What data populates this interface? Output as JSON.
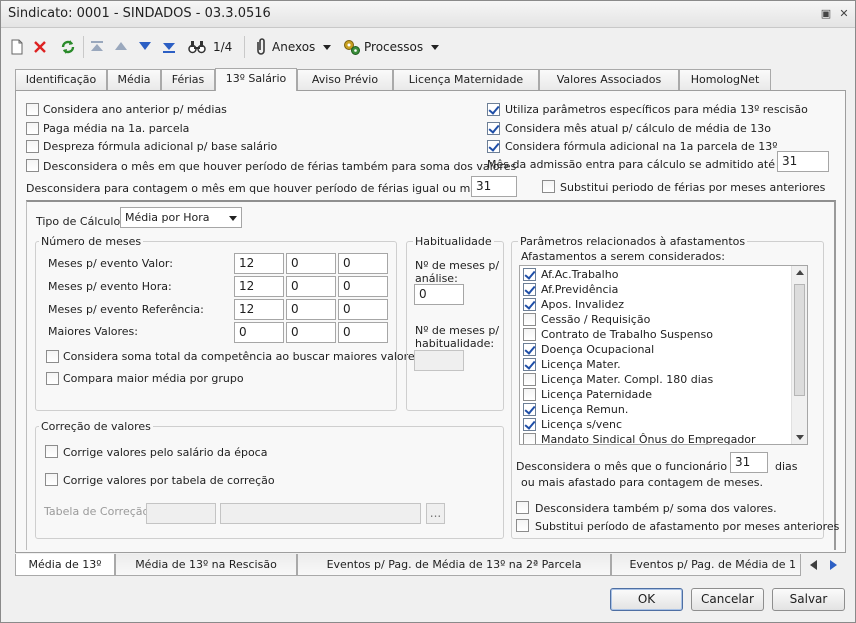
{
  "window": {
    "title": "Sindicato: 0001 - SINDADOS - 03.3.0516",
    "title_buttons": [
      "▣",
      "✕"
    ]
  },
  "toolbar": {
    "record_count": "1/4",
    "annexes_label": "Anexos",
    "processes_label": "Processos"
  },
  "tabs": [
    "Identificação",
    "Média",
    "Férias",
    "13º Salário",
    "Aviso Prévio",
    "Licença Maternidade",
    "Valores Associados",
    "HomologNet"
  ],
  "options": {
    "left": [
      {
        "label": "Considera ano anterior p/ médias",
        "checked": false
      },
      {
        "label": "Paga média na 1a. parcela",
        "checked": false
      },
      {
        "label": "Despreza fórmula adicional p/ base salário",
        "checked": false
      },
      {
        "label": "Desconsidera o mês em que houver período de férias também para soma dos valores",
        "checked": false
      }
    ],
    "right": [
      {
        "label": "Utiliza parâmetros específicos para média 13º rescisão",
        "checked": true
      },
      {
        "label": "Considera mês atual  p/ cálculo de média de 13o",
        "checked": true
      },
      {
        "label": "Considera fórmula adicional na  1a parcela de 13º",
        "checked": true
      }
    ],
    "admission_label": "Mês da admissão entra para cálculo se admitido até dia",
    "admission_value": "31",
    "vacation_count_label": "Desconsidera para contagem o mês em que houver período de férias igual ou maior a",
    "vacation_count_value": "31",
    "replace_vacation_label": "Substitui periodo de  férias por meses anteriores",
    "replace_vacation_checked": false
  },
  "calc": {
    "type_label": "Tipo de Cálculo",
    "type_value": "Média por Hora"
  },
  "months_group": {
    "title": "Número de meses",
    "rows": [
      {
        "label": "Meses p/ evento Valor:",
        "values": [
          "12",
          "0",
          "0"
        ]
      },
      {
        "label": "Meses p/ evento Hora:",
        "values": [
          "12",
          "0",
          "0"
        ]
      },
      {
        "label": "Meses p/ evento Referência:",
        "values": [
          "12",
          "0",
          "0"
        ]
      },
      {
        "label": "Maiores Valores:",
        "values": [
          "0",
          "0",
          "0"
        ]
      }
    ],
    "sum_total_label": "Considera soma total da competência ao buscar maiores valores",
    "compare_group_label": "Compara maior média por grupo"
  },
  "habituality": {
    "title": "Habitualidade",
    "analysis_label_1": "Nº de meses p/",
    "analysis_label_2": "análise:",
    "analysis_value": "0",
    "habit_label_1": "Nº de meses p/",
    "habit_label_2": "habitualidade:",
    "habit_value": ""
  },
  "absence": {
    "title": "Parâmetros relacionados à afastamentos",
    "list_label": "Afastamentos a serem considerados:",
    "items": [
      {
        "label": "Af.Ac.Trabalho",
        "checked": true
      },
      {
        "label": "Af.Previdência",
        "checked": true
      },
      {
        "label": "Apos. Invalidez",
        "checked": true
      },
      {
        "label": "Cessão / Requisição",
        "checked": false
      },
      {
        "label": "Contrato de Trabalho Suspenso",
        "checked": false
      },
      {
        "label": "Doença Ocupacional",
        "checked": true
      },
      {
        "label": "Licença Mater.",
        "checked": true
      },
      {
        "label": "Licença Mater. Compl. 180 dias",
        "checked": false
      },
      {
        "label": "Licença Paternidade",
        "checked": false
      },
      {
        "label": "Licença Remun.",
        "checked": true
      },
      {
        "label": "Licença s/venc",
        "checked": true
      },
      {
        "label": "Mandato Sindical Ônus do Empregador",
        "checked": false
      }
    ],
    "disregard_label_1": "Desconsidera o mês que o funcionário ficar",
    "disregard_value": "31",
    "disregard_days": "dias",
    "disregard_label_2": "ou mais afastado para contagem de meses.",
    "also_sum_label": "Desconsidera também p/ soma dos valores.",
    "replace_label": "Substitui período de afastamento por meses anteriores"
  },
  "correction": {
    "title": "Correção de valores",
    "by_salary_label": "Corrige valores pelo salário da época",
    "by_table_label": "Corrige valores por tabela de correção",
    "table_label": "Tabela de Correção:",
    "browse_label": "..."
  },
  "bottom_tabs": [
    "Média de 13º",
    "Média de 13º na Rescisão",
    "Eventos p/ Pag. de Média de 13º na 2ª Parcela",
    "Eventos p/ Pag. de Média de 1"
  ],
  "buttons": {
    "ok": "OK",
    "cancel": "Cancelar",
    "save": "Salvar"
  }
}
